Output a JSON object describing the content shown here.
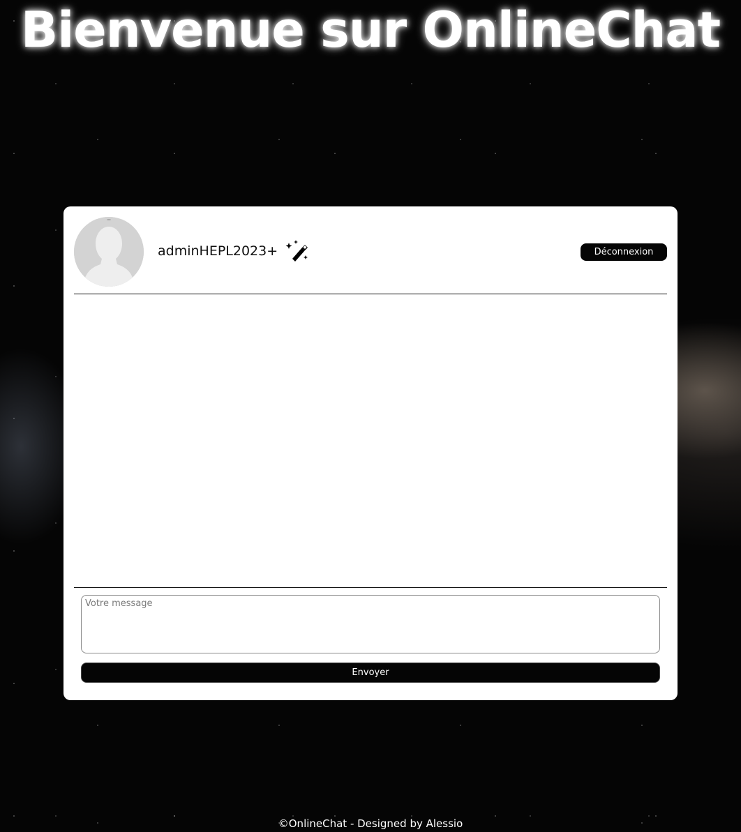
{
  "header": {
    "title": "Bienvenue sur OnlineChat"
  },
  "chat": {
    "user": {
      "avatar_icon": "default-user-avatar",
      "username": "adminHEPL2023+",
      "role_icon": "magic-wand-icon"
    },
    "logout_label": "Déconnexion",
    "messages": [],
    "composer": {
      "placeholder": "Votre message",
      "value": "",
      "send_label": "Envoyer"
    }
  },
  "footer": {
    "text": "©OnlineChat - Designed by Alessio"
  },
  "colors": {
    "background": "#050505",
    "card": "#ffffff",
    "button": "#050505",
    "button_text": "#ffffff"
  }
}
